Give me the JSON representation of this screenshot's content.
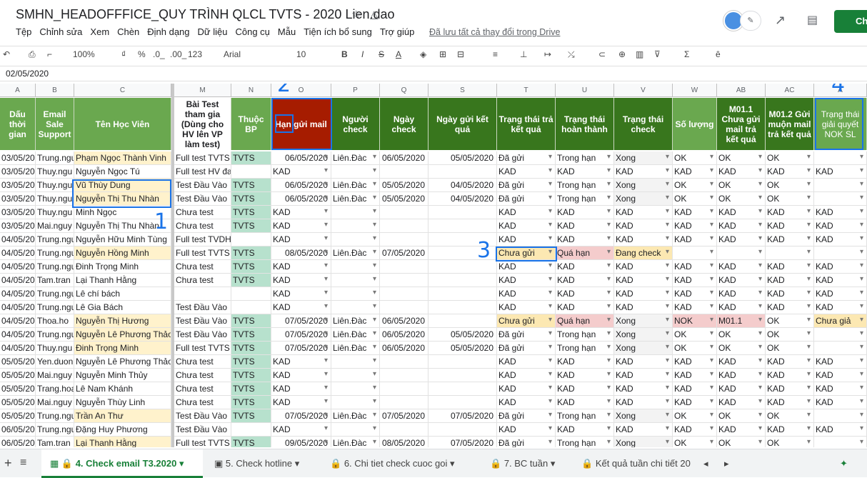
{
  "title": "SMHN_HEADOFFFICE_QUY TRÌNH QLCL TVTS - 2020 Lien.dao",
  "menu": [
    "Tệp",
    "Chỉnh sửa",
    "Xem",
    "Chèn",
    "Định dạng",
    "Dữ liệu",
    "Công cụ",
    "Mẫu",
    "Tiện ích bổ sung",
    "Trợ giúp"
  ],
  "saved_status": "Đã lưu tất cả thay đổi trong Drive",
  "share_label": "Ch",
  "toolbar": {
    "zoom": "100%",
    "currency": "₫",
    "percent": "%",
    "dec_less": ".0_",
    "dec_more": ".00_",
    "format_more": "123",
    "font": "Arial",
    "font_size": "10",
    "bold": "B",
    "italic": "I",
    "strike": "S",
    "text_color": "A"
  },
  "cell_ref": "02/05/2020",
  "column_letters": [
    "A",
    "B",
    "C",
    "M",
    "N",
    "O",
    "P",
    "Q",
    "S",
    "T",
    "U",
    "V",
    "W",
    "AB",
    "AC",
    "A"
  ],
  "headers": {
    "A": "Dấu thời gian",
    "B": "Email Sale Support",
    "C": "Tên Học Viên",
    "M": "Bài Test tham gia (Dùng cho HV lên VP làm test)",
    "N": "Thuộc BP",
    "O": "Hạn gửi mail",
    "P": "Người check",
    "Q": "Ngày check",
    "S": "Ngày gửi kết quả",
    "T": "Trạng thái trả kết quả",
    "U": "Trạng thái hoàn thành",
    "V": "Trạng thái check",
    "W": "Số lượng",
    "AB": "M01.1 Chưa gửi mail trả kết quả",
    "AC": "M01.2 Gửi muộn mail trả kết quả",
    "AD": "Trạng thái giải quyết NOK SL"
  },
  "rows": [
    {
      "A": "03/05/202",
      "B": "Trung.ngu",
      "C": "Phạm Ngọc Thành Vinh",
      "M": "Full test TVTS",
      "N": "TVTS",
      "O": "06/05/2020",
      "P": "Liên.Đàc",
      "Q": "06/05/2020",
      "S": "05/05/2020",
      "T": "Đã gửi",
      "U": "Trong hạn",
      "V": "Xong",
      "W": "OK",
      "AB": "OK",
      "AC": "OK",
      "AD": ""
    },
    {
      "A": "03/05/202",
      "B": "Thuy.ngu",
      "C": "Nguyễn Ngọc Tú",
      "M": "Full test HV đa",
      "N": "",
      "O": "KAD",
      "P": "",
      "Q": "",
      "S": "",
      "T": "KAD",
      "U": "KAD",
      "V": "KAD",
      "W": "KAD",
      "AB": "KAD",
      "AC": "KAD",
      "AD": "KAD"
    },
    {
      "A": "03/05/202",
      "B": "Thuy.ngu",
      "C": "Vũ Thùy Dung",
      "M": "Test Đầu Vào",
      "N": "TVTS",
      "O": "06/05/2020",
      "P": "Liên.Đàc",
      "Q": "05/05/2020",
      "S": "04/05/2020",
      "T": "Đã gửi",
      "U": "Trong hạn",
      "V": "Xong",
      "W": "OK",
      "AB": "OK",
      "AC": "OK",
      "AD": ""
    },
    {
      "A": "03/05/202",
      "B": "Thuy.ngu",
      "C": "Nguyễn Thị Thu Nhàn",
      "M": "Test Đầu Vào",
      "N": "TVTS",
      "O": "06/05/2020",
      "P": "Liên.Đàc",
      "Q": "05/05/2020",
      "S": "04/05/2020",
      "T": "Đã gửi",
      "U": "Trong hạn",
      "V": "Xong",
      "W": "OK",
      "AB": "OK",
      "AC": "OK",
      "AD": ""
    },
    {
      "A": "03/05/202",
      "B": "Thuy.ngu",
      "C": "Minh Ngọc",
      "M": "Chưa test",
      "N": "TVTS",
      "O": "KAD",
      "P": "",
      "Q": "",
      "S": "",
      "T": "KAD",
      "U": "KAD",
      "V": "KAD",
      "W": "KAD",
      "AB": "KAD",
      "AC": "KAD",
      "AD": "KAD"
    },
    {
      "A": "03/05/202",
      "B": "Mai.nguy",
      "C": "Nguyễn Thị Thu Nhàn",
      "M": "Chưa test",
      "N": "TVTS",
      "O": "KAD",
      "P": "",
      "Q": "",
      "S": "",
      "T": "KAD",
      "U": "KAD",
      "V": "KAD",
      "W": "KAD",
      "AB": "KAD",
      "AC": "KAD",
      "AD": "KAD"
    },
    {
      "A": "04/05/202",
      "B": "Trung.ngu",
      "C": "Nguyễn Hữu Minh Tùng",
      "M": "Full test TVDH",
      "N": "",
      "O": "KAD",
      "P": "",
      "Q": "",
      "S": "",
      "T": "KAD",
      "U": "KAD",
      "V": "KAD",
      "W": "KAD",
      "AB": "KAD",
      "AC": "KAD",
      "AD": "KAD"
    },
    {
      "A": "04/05/202",
      "B": "Trung.ngu",
      "C": "Nguyễn Hồng Minh",
      "M": "Full test TVTS",
      "N": "TVTS",
      "O": "08/05/2020",
      "P": "Liên.Đàc",
      "Q": "07/05/2020",
      "S": "",
      "T": "Chưa gửi",
      "U": "Quá hạn",
      "V": "Đang check",
      "W": "",
      "AB": "",
      "AC": "",
      "AD": ""
    },
    {
      "A": "04/05/202",
      "B": "Trung.ngu",
      "C": "Đinh Trọng Minh",
      "M": "Chưa test",
      "N": "TVTS",
      "O": "KAD",
      "P": "",
      "Q": "",
      "S": "",
      "T": "KAD",
      "U": "KAD",
      "V": "KAD",
      "W": "KAD",
      "AB": "KAD",
      "AC": "KAD",
      "AD": "KAD"
    },
    {
      "A": "04/05/202",
      "B": "Tam.tran",
      "C": "Lại Thanh Hằng",
      "M": "Chưa test",
      "N": "TVTS",
      "O": "KAD",
      "P": "",
      "Q": "",
      "S": "",
      "T": "KAD",
      "U": "KAD",
      "V": "KAD",
      "W": "KAD",
      "AB": "KAD",
      "AC": "KAD",
      "AD": "KAD"
    },
    {
      "A": "04/05/202",
      "B": "Trung.ngu",
      "C": "Lê chí bách",
      "M": "",
      "N": "",
      "O": "KAD",
      "P": "",
      "Q": "",
      "S": "",
      "T": "KAD",
      "U": "KAD",
      "V": "KAD",
      "W": "KAD",
      "AB": "KAD",
      "AC": "KAD",
      "AD": "KAD"
    },
    {
      "A": "04/05/202",
      "B": "Trung.ngu",
      "C": "Lê Gia Bách",
      "M": "Test Đầu Vào",
      "N": "",
      "O": "KAD",
      "P": "",
      "Q": "",
      "S": "",
      "T": "KAD",
      "U": "KAD",
      "V": "KAD",
      "W": "KAD",
      "AB": "KAD",
      "AC": "KAD",
      "AD": "KAD"
    },
    {
      "A": "04/05/202",
      "B": "Thoa.ho",
      "C": "Nguyễn Thị Hương",
      "M": "Test Đầu Vào",
      "N": "TVTS",
      "O": "07/05/2020",
      "P": "Liên.Đàc",
      "Q": "06/05/2020",
      "S": "",
      "T": "Chưa gửi",
      "U": "Quá hạn",
      "V": "Xong",
      "W": "NOK",
      "AB": "M01.1",
      "AC": "OK",
      "AD": "Chưa giả"
    },
    {
      "A": "04/05/202",
      "B": "Trung.ngu",
      "C": "Nguyễn Lê Phương Thảo",
      "M": "Test Đầu Vào",
      "N": "TVTS",
      "O": "07/05/2020",
      "P": "Liên.Đàc",
      "Q": "06/05/2020",
      "S": "05/05/2020",
      "T": "Đã gửi",
      "U": "Trong hạn",
      "V": "Xong",
      "W": "OK",
      "AB": "OK",
      "AC": "OK",
      "AD": ""
    },
    {
      "A": "04/05/202",
      "B": "Thuy.ngu",
      "C": "Đinh Trọng Minh",
      "M": "Full test TVTS",
      "N": "TVTS",
      "O": "07/05/2020",
      "P": "Liên.Đàc",
      "Q": "06/05/2020",
      "S": "05/05/2020",
      "T": "Đã gửi",
      "U": "Trong hạn",
      "V": "Xong",
      "W": "OK",
      "AB": "OK",
      "AC": "OK",
      "AD": ""
    },
    {
      "A": "05/05/202",
      "B": "Yen.duon",
      "C": "Nguyễn Lê Phương Thảo",
      "M": "Chưa test",
      "N": "TVTS",
      "O": "KAD",
      "P": "",
      "Q": "",
      "S": "",
      "T": "KAD",
      "U": "KAD",
      "V": "KAD",
      "W": "KAD",
      "AB": "KAD",
      "AC": "KAD",
      "AD": "KAD"
    },
    {
      "A": "05/05/202",
      "B": "Mai.nguy",
      "C": "Nguyễn Minh Thủy",
      "M": "Chưa test",
      "N": "TVTS",
      "O": "KAD",
      "P": "",
      "Q": "",
      "S": "",
      "T": "KAD",
      "U": "KAD",
      "V": "KAD",
      "W": "KAD",
      "AB": "KAD",
      "AC": "KAD",
      "AD": "KAD"
    },
    {
      "A": "05/05/202",
      "B": "Trang.hoa",
      "C": "Lê Nam Khánh",
      "M": "Chưa test",
      "N": "TVTS",
      "O": "KAD",
      "P": "",
      "Q": "",
      "S": "",
      "T": "KAD",
      "U": "KAD",
      "V": "KAD",
      "W": "KAD",
      "AB": "KAD",
      "AC": "KAD",
      "AD": "KAD"
    },
    {
      "A": "05/05/202",
      "B": "Mai.nguy",
      "C": "Nguyễn Thùy Linh",
      "M": "Chưa test",
      "N": "TVTS",
      "O": "KAD",
      "P": "",
      "Q": "",
      "S": "",
      "T": "KAD",
      "U": "KAD",
      "V": "KAD",
      "W": "KAD",
      "AB": "KAD",
      "AC": "KAD",
      "AD": "KAD"
    },
    {
      "A": "05/05/202",
      "B": "Trung.ngu",
      "C": "Trần An Thư",
      "M": "Test Đầu Vào",
      "N": "TVTS",
      "O": "07/05/2020",
      "P": "Liên.Đàc",
      "Q": "07/05/2020",
      "S": "07/05/2020",
      "T": "Đã gửi",
      "U": "Trong hạn",
      "V": "Xong",
      "W": "OK",
      "AB": "OK",
      "AC": "OK",
      "AD": ""
    },
    {
      "A": "06/05/202",
      "B": "Trung.ngu",
      "C": "Đặng Huy Phương",
      "M": "Test Đầu Vào",
      "N": "",
      "O": "KAD",
      "P": "",
      "Q": "",
      "S": "",
      "T": "KAD",
      "U": "KAD",
      "V": "KAD",
      "W": "KAD",
      "AB": "KAD",
      "AC": "KAD",
      "AD": "KAD"
    },
    {
      "A": "06/05/202",
      "B": "Tam.tran",
      "C": "Lại Thanh Hằng",
      "M": "Full test TVTS",
      "N": "TVTS",
      "O": "09/05/2020",
      "P": "Liên.Đàc",
      "Q": "08/05/2020",
      "S": "07/05/2020",
      "T": "Đã gửi",
      "U": "Trong hạn",
      "V": "Xong",
      "W": "OK",
      "AB": "OK",
      "AC": "OK",
      "AD": ""
    }
  ],
  "annotations": [
    "1",
    "2",
    "3",
    "4"
  ],
  "sheet_tabs": [
    "4. Check email T3.2020",
    "5. Check hotline",
    "6. Chi tiet check cuoc goi",
    "7. BC tuần",
    "Kết quả tuần chi tiết 20"
  ],
  "colors": {
    "header_green": "#6aa84f",
    "header_dark": "#38761d",
    "header_red": "#a61c00",
    "annotation_blue": "#1a73e8",
    "share_green": "#188038"
  }
}
